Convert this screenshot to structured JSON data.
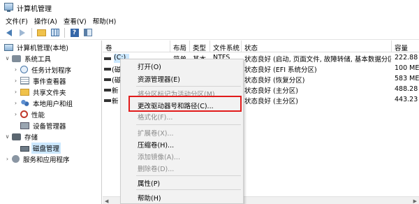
{
  "window": {
    "title": "计算机管理"
  },
  "menubar": {
    "items": [
      "文件(F)",
      "操作(A)",
      "查看(V)",
      "帮助(H)"
    ]
  },
  "toolbar": {
    "icons": [
      "back-arrow-icon",
      "forward-arrow-icon",
      "up-folder-icon",
      "properties-icon",
      "help-icon",
      "show-hide-pane-icon"
    ]
  },
  "tree": {
    "items": [
      {
        "label": "计算机管理(本地)",
        "icon": "computer-icon",
        "expander": "",
        "level": 0
      },
      {
        "label": "系统工具",
        "icon": "tools-icon",
        "expander": "∨",
        "level": 1
      },
      {
        "label": "任务计划程序",
        "icon": "clock-icon",
        "expander": "›",
        "level": 2
      },
      {
        "label": "事件查看器",
        "icon": "event-log-icon",
        "expander": "›",
        "level": 2
      },
      {
        "label": "共享文件夹",
        "icon": "shared-folder-icon",
        "expander": "›",
        "level": 2
      },
      {
        "label": "本地用户和组",
        "icon": "users-icon",
        "expander": "›",
        "level": 2
      },
      {
        "label": "性能",
        "icon": "performance-icon",
        "expander": "›",
        "level": 2
      },
      {
        "label": "设备管理器",
        "icon": "device-manager-icon",
        "expander": "",
        "level": 2
      },
      {
        "label": "存储",
        "icon": "storage-icon",
        "expander": "∨",
        "level": 1
      },
      {
        "label": "磁盘管理",
        "icon": "disk-icon",
        "expander": "",
        "level": 2,
        "selected": true
      },
      {
        "label": "服务和应用程序",
        "icon": "services-icon",
        "expander": "›",
        "level": 1
      }
    ]
  },
  "table": {
    "columns": [
      "卷",
      "布局",
      "类型",
      "文件系统",
      "状态",
      "容量"
    ],
    "rows": [
      {
        "volume": "(C:)",
        "layout": "简单",
        "type": "基本",
        "fs": "NTFS",
        "status": "状态良好 (启动, 页面文件, 故障转储, 基本数据分区)",
        "capacity": "222.88"
      },
      {
        "volume": "(磁",
        "layout": "",
        "type": "",
        "fs": "",
        "status": "状态良好 (EFI 系统分区)",
        "capacity": "100 ME"
      },
      {
        "volume": "(磁",
        "layout": "",
        "type": "",
        "fs": "",
        "status": "状态良好 (恢复分区)",
        "capacity": "583 ME"
      },
      {
        "volume": "新",
        "layout": "",
        "type": "",
        "fs": "",
        "status": "状态良好 (主分区)",
        "capacity": "488.28"
      },
      {
        "volume": "新",
        "layout": "",
        "type": "",
        "fs": "",
        "status": "状态良好 (主分区)",
        "capacity": "443.23"
      }
    ]
  },
  "context_menu": {
    "items": [
      {
        "label": "打开(O)",
        "enabled": true
      },
      {
        "label": "资源管理器(E)",
        "enabled": true
      },
      {
        "separator": true
      },
      {
        "label": "将分区标记为活动分区(M)",
        "enabled": false
      },
      {
        "label": "更改驱动器号和路径(C)...",
        "enabled": true,
        "highlighted": true
      },
      {
        "label": "格式化(F)...",
        "enabled": false
      },
      {
        "separator": true
      },
      {
        "label": "扩展卷(X)...",
        "enabled": false
      },
      {
        "label": "压缩卷(H)...",
        "enabled": true
      },
      {
        "label": "添加镜像(A)...",
        "enabled": false
      },
      {
        "label": "删除卷(D)...",
        "enabled": false
      },
      {
        "separator": true
      },
      {
        "label": "属性(P)",
        "enabled": true
      },
      {
        "separator": true
      },
      {
        "label": "帮助(H)",
        "enabled": true
      }
    ]
  },
  "colors": {
    "highlight_border": "#e11b1b",
    "selection": "#cce8ff",
    "menu_background": "#f2f2f2"
  }
}
